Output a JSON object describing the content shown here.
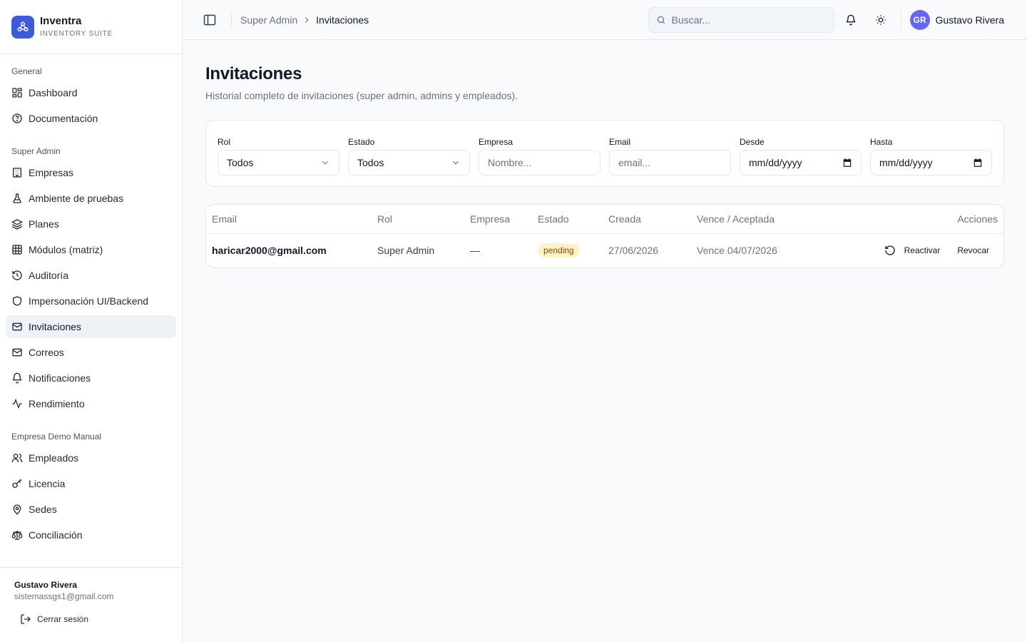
{
  "brand": {
    "name": "Inventra",
    "subtitle": "INVENTORY SUITE"
  },
  "sidebar": {
    "sections": [
      {
        "title": "General",
        "items": [
          {
            "label": "Dashboard",
            "icon": "dashboard-icon"
          },
          {
            "label": "Documentación",
            "icon": "help-circle-icon"
          }
        ]
      },
      {
        "title": "Super Admin",
        "items": [
          {
            "label": "Empresas",
            "icon": "building-icon"
          },
          {
            "label": "Ambiente de pruebas",
            "icon": "flask-icon"
          },
          {
            "label": "Planes",
            "icon": "layers-icon"
          },
          {
            "label": "Módulos (matriz)",
            "icon": "grid-table-icon"
          },
          {
            "label": "Auditoría",
            "icon": "history-icon"
          },
          {
            "label": "Impersonación UI/Backend",
            "icon": "shield-icon"
          },
          {
            "label": "Invitaciones",
            "icon": "mail-icon",
            "active": true
          },
          {
            "label": "Correos",
            "icon": "mail-icon"
          },
          {
            "label": "Notificaciones",
            "icon": "bell-icon"
          },
          {
            "label": "Rendimiento",
            "icon": "activity-icon"
          }
        ]
      },
      {
        "title": "Empresa Demo Manual",
        "items": [
          {
            "label": "Empleados",
            "icon": "users-icon"
          },
          {
            "label": "Licencia",
            "icon": "key-icon"
          },
          {
            "label": "Sedes",
            "icon": "map-pin-icon"
          },
          {
            "label": "Conciliación",
            "icon": "scale-icon"
          }
        ]
      }
    ],
    "footer": {
      "name": "Gustavo Rivera",
      "email": "sistemassgs1@gmail.com",
      "logout": "Cerrar sesión"
    }
  },
  "topbar": {
    "breadcrumb": [
      "Super Admin",
      "Invitaciones"
    ],
    "search_placeholder": "Buscar...",
    "user": {
      "initials": "GR",
      "name": "Gustavo Rivera"
    }
  },
  "page": {
    "title": "Invitaciones",
    "subtitle": "Historial completo de invitaciones (super admin, admins y empleados)."
  },
  "filters": {
    "rol": {
      "label": "Rol",
      "value": "Todos"
    },
    "estado": {
      "label": "Estado",
      "value": "Todos"
    },
    "empresa": {
      "label": "Empresa",
      "placeholder": "Nombre..."
    },
    "email": {
      "label": "Email",
      "placeholder": "email..."
    },
    "desde": {
      "label": "Desde",
      "value": "mm/dd/yyyy"
    },
    "hasta": {
      "label": "Hasta",
      "value": "mm/dd/yyyy"
    }
  },
  "table": {
    "headers": [
      "Email",
      "Rol",
      "Empresa",
      "Estado",
      "Creada",
      "Vence / Aceptada",
      "Acciones"
    ],
    "rows": [
      {
        "email": "haricar2000@gmail.com",
        "rol": "Super Admin",
        "empresa": "—",
        "estado": "pending",
        "creada": "27/06/2026",
        "vence": "Vence 04/07/2026",
        "action_reactivar": "Reactivar",
        "action_revocar": "Revocar"
      }
    ]
  },
  "colors": {
    "brand": "#3b5bdb",
    "avatar": "#6366f1",
    "pending_badge_bg": "#fef3c7",
    "pending_badge_text": "#92400e"
  }
}
